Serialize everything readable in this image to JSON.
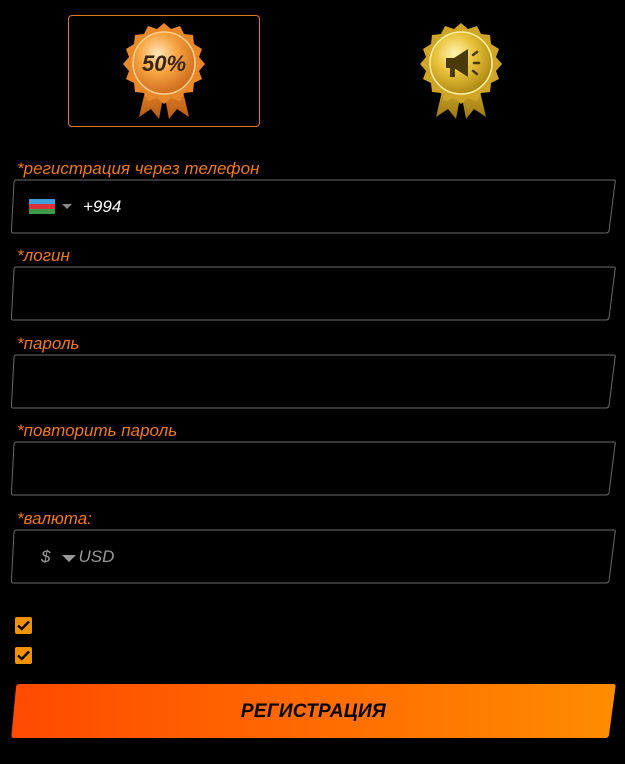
{
  "bonuses": [
    {
      "badge_text": "50%",
      "icon": "medal-50-percent-icon",
      "selected": true
    },
    {
      "icon": "megaphone-medal-icon",
      "selected": false
    }
  ],
  "form": {
    "phone": {
      "label": "*регистрация через телефон",
      "country_flag": "azerbaijan-flag-icon",
      "code": "+994"
    },
    "login": {
      "label": "*логин",
      "value": ""
    },
    "password": {
      "label": "*пароль",
      "value": ""
    },
    "repeat_password": {
      "label": "*повторить пароль",
      "value": ""
    },
    "currency": {
      "label": "*валюта:",
      "symbol": "$",
      "value": "USD"
    },
    "checkboxes": [
      {
        "checked": true
      },
      {
        "checked": true
      }
    ],
    "submit_label": "РЕГИСТРАЦИЯ"
  },
  "colors": {
    "accent": "#f07a1c",
    "checkbox": "#f39200",
    "button_gradient_start": "#ff4a00",
    "button_gradient_end": "#ff8c00",
    "field_border": "#6a6a6a",
    "background": "#000000"
  }
}
